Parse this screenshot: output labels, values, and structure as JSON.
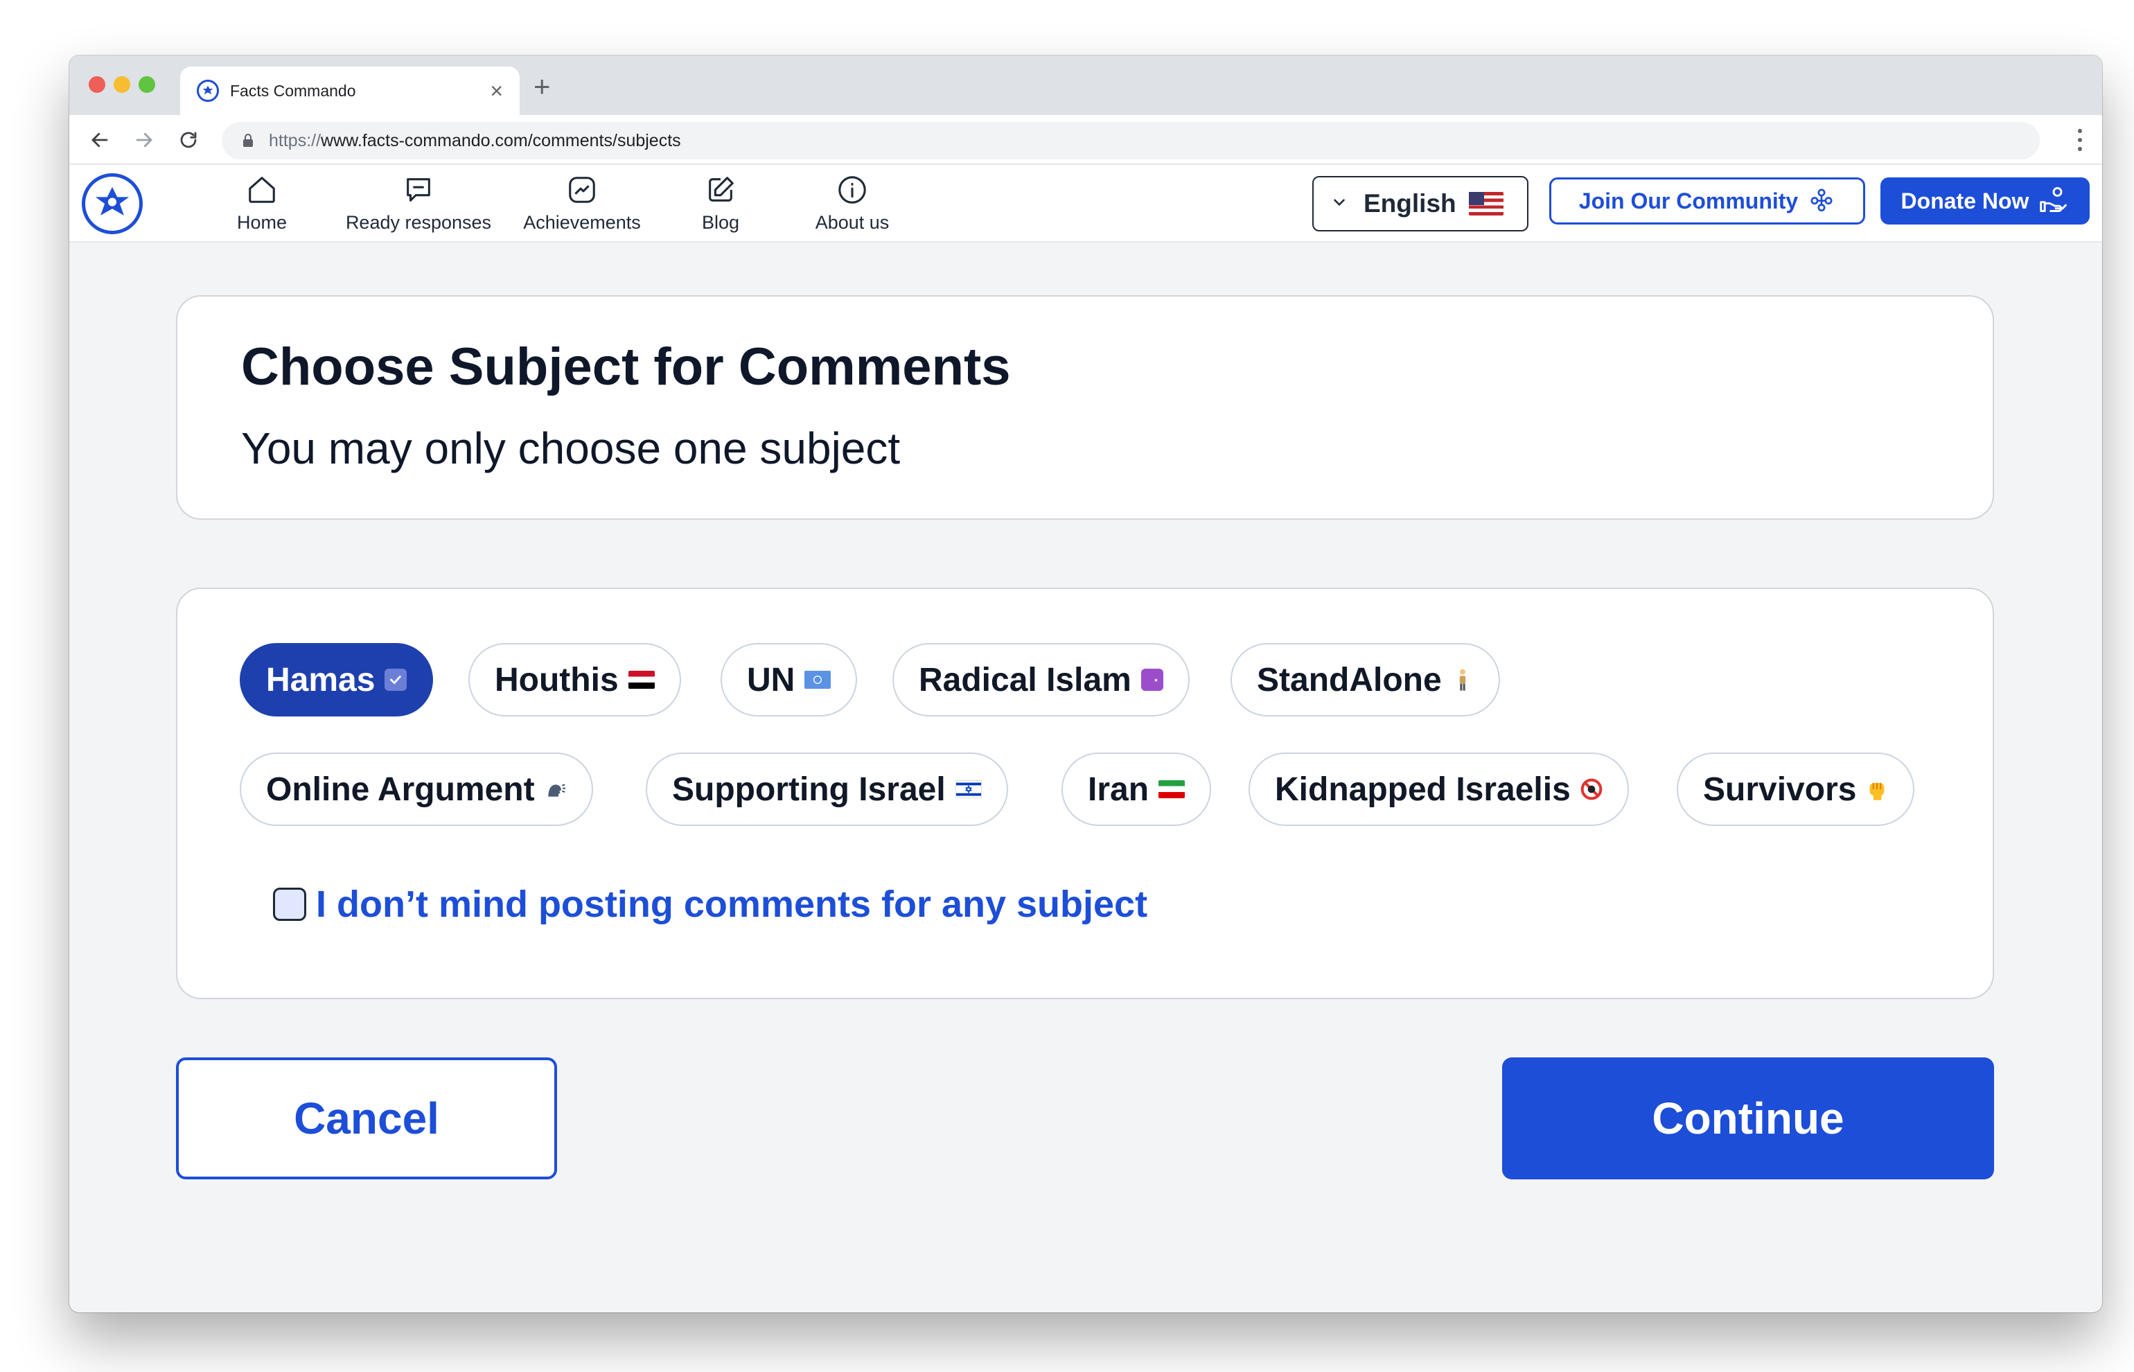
{
  "browser": {
    "tab_title": "Facts Commando",
    "url_scheme": "https://",
    "url_rest": "www.facts-commando.com/comments/subjects"
  },
  "header": {
    "nav": [
      {
        "label": "Home",
        "icon": "home-icon"
      },
      {
        "label": "Ready responses",
        "icon": "chat-bubble-icon"
      },
      {
        "label": "Achievements",
        "icon": "trend-chart-icon"
      },
      {
        "label": "Blog",
        "icon": "edit-icon"
      },
      {
        "label": "About us",
        "icon": "info-icon"
      }
    ],
    "language": "English",
    "join_label": "Join Our Community",
    "donate_label": "Donate Now"
  },
  "page": {
    "title": "Choose Subject for Comments",
    "subtitle": "You may only choose one subject"
  },
  "subjects": [
    {
      "label": "Hamas",
      "emoji": "check-box-emoji",
      "selected": true
    },
    {
      "label": "Houthis",
      "emoji": "yemen-flag-emoji",
      "selected": false
    },
    {
      "label": "UN",
      "emoji": "un-flag-emoji",
      "selected": false
    },
    {
      "label": "Radical Islam",
      "emoji": "star-crescent-emoji",
      "selected": false
    },
    {
      "label": "StandAlone",
      "emoji": "standing-person-emoji",
      "selected": false
    },
    {
      "label": "Online Argument",
      "emoji": "speaking-head-emoji",
      "selected": false
    },
    {
      "label": "Supporting Israel",
      "emoji": "israel-flag-emoji",
      "selected": false
    },
    {
      "label": "Iran",
      "emoji": "iran-flag-emoji",
      "selected": false
    },
    {
      "label": "Kidnapped Israelis",
      "emoji": "no-under-18-emoji",
      "selected": false
    },
    {
      "label": "Survivors",
      "emoji": "raised-fist-emoji",
      "selected": false
    }
  ],
  "any_subject_label": "I don’t mind posting comments for any subject",
  "any_subject_checked": false,
  "actions": {
    "cancel_label": "Cancel",
    "continue_label": "Continue"
  },
  "colors": {
    "brand_blue": "#1d4ed8",
    "selected_chip": "#1e40af",
    "title_text": "#0f172a"
  }
}
